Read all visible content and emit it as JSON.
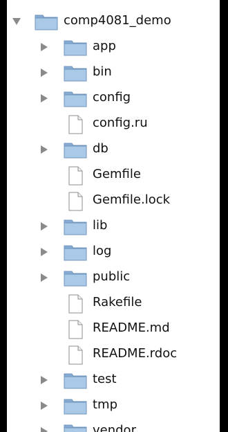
{
  "tree": {
    "root": {
      "name": "comp4081_demo",
      "type": "folder",
      "expanded": true,
      "icon": "folder-icon"
    },
    "items": [
      {
        "name": "app",
        "type": "folder",
        "icon": "folder-icon"
      },
      {
        "name": "bin",
        "type": "folder",
        "icon": "folder-icon"
      },
      {
        "name": "config",
        "type": "folder",
        "icon": "folder-icon"
      },
      {
        "name": "config.ru",
        "type": "file",
        "icon": "document-icon"
      },
      {
        "name": "db",
        "type": "folder",
        "icon": "folder-icon"
      },
      {
        "name": "Gemfile",
        "type": "file",
        "icon": "document-icon"
      },
      {
        "name": "Gemfile.lock",
        "type": "file",
        "icon": "document-icon"
      },
      {
        "name": "lib",
        "type": "folder",
        "icon": "folder-icon"
      },
      {
        "name": "log",
        "type": "folder",
        "icon": "folder-icon"
      },
      {
        "name": "public",
        "type": "folder",
        "icon": "folder-icon"
      },
      {
        "name": "Rakefile",
        "type": "file",
        "icon": "document-icon"
      },
      {
        "name": "README.md",
        "type": "file",
        "icon": "document-icon"
      },
      {
        "name": "README.rdoc",
        "type": "file",
        "icon": "document-icon"
      },
      {
        "name": "test",
        "type": "folder",
        "icon": "folder-icon"
      },
      {
        "name": "tmp",
        "type": "folder",
        "icon": "folder-icon"
      },
      {
        "name": "vendor",
        "type": "folder",
        "icon": "folder-icon"
      }
    ]
  },
  "colors": {
    "folder_fill": "#a9c9e6",
    "folder_tab": "#86acd3",
    "disclosure": "#8a8a8a",
    "background": "#ffffff"
  }
}
